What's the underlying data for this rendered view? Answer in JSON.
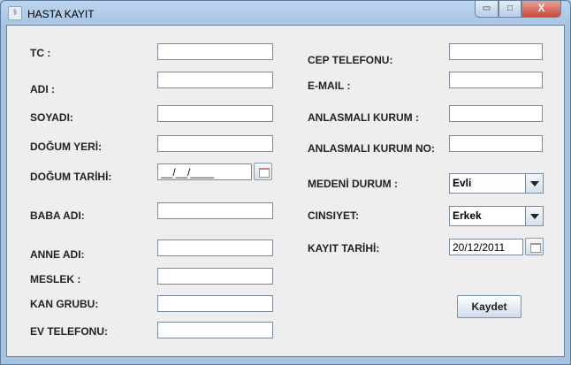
{
  "window": {
    "title": "HASTA KAYIT",
    "minimize": "▭",
    "maximize": "□",
    "close": "X"
  },
  "left": [
    {
      "label": "TC    :",
      "value": ""
    },
    {
      "label": "ADI    :",
      "value": ""
    },
    {
      "label": "SOYADI:",
      "value": ""
    },
    {
      "label": "DOĞUM YERİ:",
      "value": ""
    },
    {
      "label": "DOĞUM TARİHİ:",
      "value": "__/__/____"
    },
    {
      "label": "BABA ADI:",
      "value": ""
    },
    {
      "label": "ANNE ADI:",
      "value": ""
    },
    {
      "label": "MESLEK :",
      "value": ""
    },
    {
      "label": "KAN GRUBU:",
      "value": ""
    },
    {
      "label": "EV TELEFONU:",
      "value": ""
    }
  ],
  "right": [
    {
      "label": "CEP TELEFONU:",
      "value": ""
    },
    {
      "label": "E-MAIL :",
      "value": ""
    },
    {
      "label": "ANLASMALI KURUM :",
      "value": ""
    },
    {
      "label": "ANLASMALI KURUM NO:",
      "value": ""
    },
    {
      "label": "MEDENİ DURUM :",
      "value": "Evli"
    },
    {
      "label": "CINSIYET:",
      "value": "Erkek"
    },
    {
      "label": "KAYIT TARİHİ:",
      "value": "20/12/2011"
    }
  ],
  "save_label": "Kaydet"
}
